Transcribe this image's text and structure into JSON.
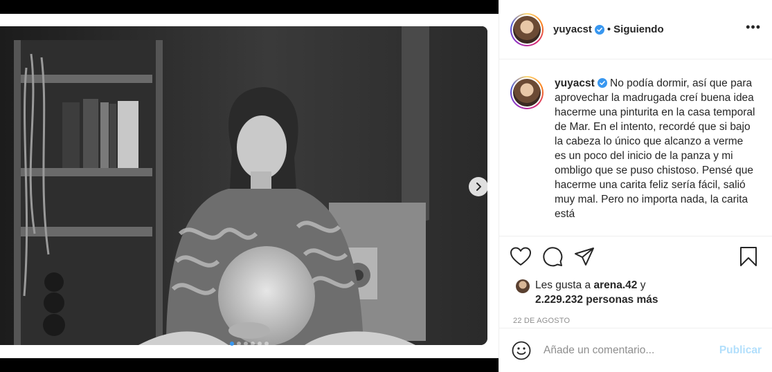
{
  "post": {
    "username": "yuyacst",
    "follow_status": "Siguiendo",
    "separator": "•",
    "more_label": "•••",
    "caption": "No podía dormir, así que para aprovechar la madrugada creí buena idea hacerme una pinturita en la casa temporal de Mar. En el intento, recordé que si bajo la cabeza lo único que alcanzo a verme es un poco del inicio de la panza y mi ombligo que se puso chistoso. Pensé que hacerme una carita feliz sería fácil, salió muy mal. Pero no importa nada, la carita está",
    "likes": {
      "prefix": "Les gusta a",
      "user": "arena.42",
      "connector": "y",
      "count": "2.229.232 personas más"
    },
    "date": "22 DE AGOSTO"
  },
  "comment": {
    "placeholder": "Añade un comentario...",
    "publish_label": "Publicar"
  },
  "carousel": {
    "slides": 6,
    "active_index": 0
  },
  "icons": {
    "verified": "verified-badge-icon",
    "like": "heart-icon",
    "comment": "comment-bubble-icon",
    "share": "paper-plane-icon",
    "save": "bookmark-icon",
    "emoji": "smiley-icon",
    "next": "chevron-right-icon"
  },
  "colors": {
    "verified_blue": "#3897f0",
    "publish_disabled": "#b2dffc",
    "muted_text": "#8e8e8e"
  }
}
